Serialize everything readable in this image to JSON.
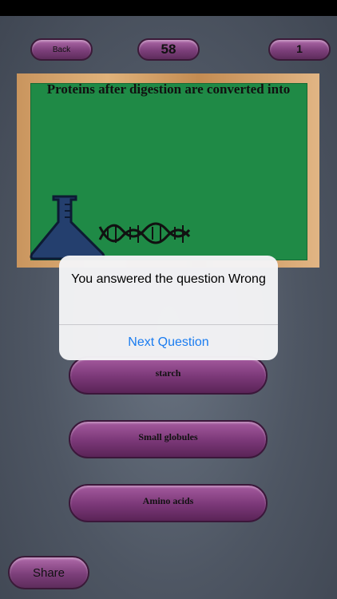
{
  "header": {
    "back_label": "Back",
    "score": "58",
    "level": "1"
  },
  "board": {
    "question": "Proteins after digestion are converted into",
    "icons": [
      "flask-icon",
      "dna-icon"
    ]
  },
  "answers": [
    "starch",
    "Small globules",
    "Amino acids"
  ],
  "alert": {
    "message": "You answered the question Wrong",
    "action_label": "Next Question"
  },
  "footer": {
    "share_label": "Share"
  },
  "colors": {
    "button_purple": "#7c3f7a",
    "board_green": "#1f8a46",
    "alert_link": "#1a7cf0"
  }
}
